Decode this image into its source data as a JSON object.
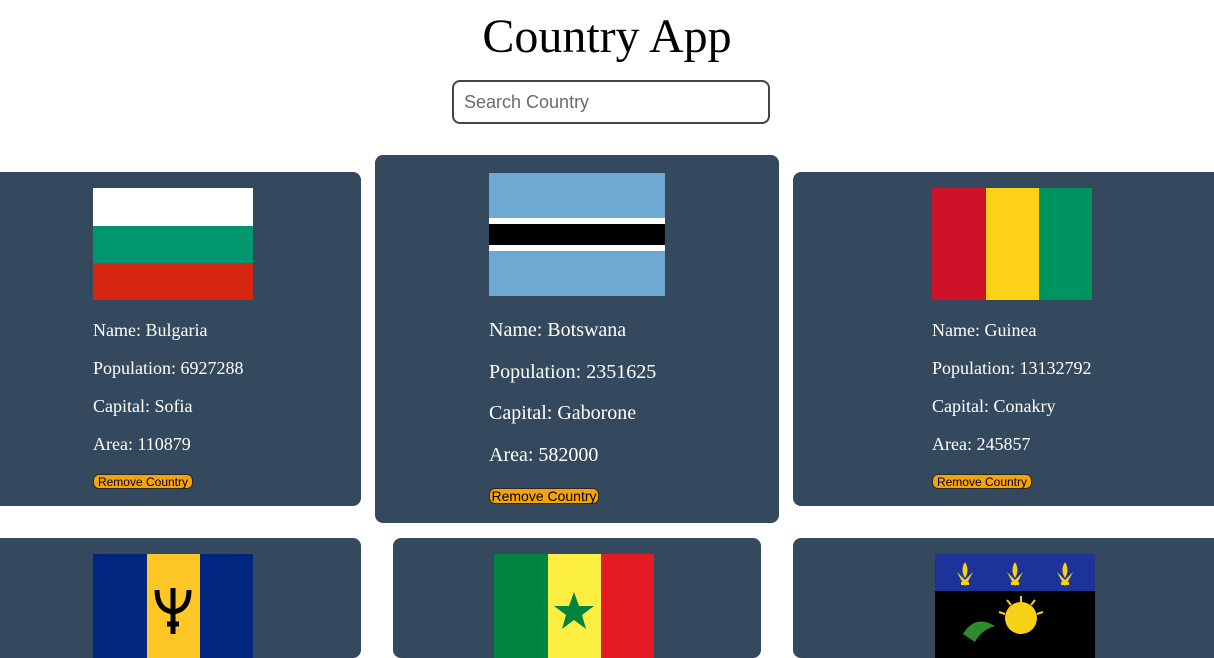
{
  "header": {
    "title": "Country App"
  },
  "search": {
    "placeholder": "Search Country",
    "value": ""
  },
  "countries": [
    {
      "name": "Name: Bulgaria",
      "population": "Population: 6927288",
      "capital": "Capital: Sofia",
      "area": "Area: 110879",
      "button": "Remove Country",
      "flag_icon": "bulgaria-flag-icon"
    },
    {
      "name": "Name: Botswana",
      "population": "Population: 2351625",
      "capital": "Capital: Gaborone",
      "area": "Area: 582000",
      "button": "Remove Country",
      "flag_icon": "botswana-flag-icon"
    },
    {
      "name": "Name: Guinea",
      "population": "Population: 13132792",
      "capital": "Capital: Conakry",
      "area": "Area: 245857",
      "button": "Remove Country",
      "flag_icon": "guinea-flag-icon"
    },
    {
      "flag_icon": "barbados-flag-icon"
    },
    {
      "flag_icon": "senegal-flag-icon"
    },
    {
      "flag_icon": "guadeloupe-flag-icon"
    }
  ],
  "colors": {
    "card_bg": "#34495e",
    "button_bg": "#f5a30a",
    "page_bg": "#ffffff"
  }
}
